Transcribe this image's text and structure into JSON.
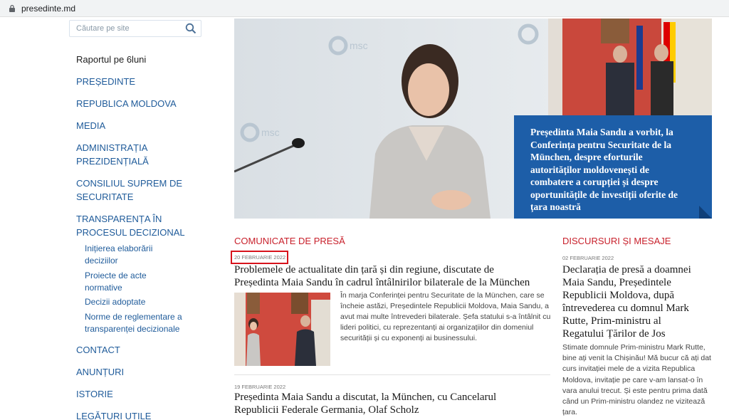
{
  "browser": {
    "url": "presedinte.md"
  },
  "search": {
    "placeholder": "Căutare pe site"
  },
  "sidebar": {
    "items": [
      {
        "label": "Raportul pe 6luni"
      },
      {
        "label": "PREȘEDINTE"
      },
      {
        "label": "REPUBLICA MOLDOVA"
      },
      {
        "label": "MEDIA"
      },
      {
        "label": "ADMINISTRAȚIA"
      },
      {
        "label": "PREZIDENȚIALĂ"
      },
      {
        "label": "CONSILIUL SUPREM DE"
      },
      {
        "label": "SECURITATE"
      },
      {
        "label": "TRANSPARENȚA ÎN"
      },
      {
        "label": "PROCESUL DECIZIONAL"
      },
      {
        "label": "Inițierea elaborării"
      },
      {
        "label": "deciziilor"
      },
      {
        "label": "Proiecte de acte"
      },
      {
        "label": "normative"
      },
      {
        "label": "Decizii adoptate"
      },
      {
        "label": "Norme de reglementare a"
      },
      {
        "label": "transparenței decizionale"
      },
      {
        "label": "CONTACT"
      },
      {
        "label": "ANUNȚURI"
      },
      {
        "label": "ISTORIE"
      },
      {
        "label": "LEGĂTURI UTILE"
      }
    ]
  },
  "hero": {
    "caption_lines": [
      "Președinta Maia Sandu a vorbit, la",
      "Conferința pentru Securitate de la",
      "München, despre eforturile",
      "autorităților moldovenești de",
      "combatere a corupției și despre",
      "oportunitățile de investiții oferite de",
      "țara noastră"
    ],
    "logo_text": "msc"
  },
  "press": {
    "title": "COMUNICATE DE PRESĂ",
    "items": [
      {
        "date": "20 FEBRUARIE 2022",
        "headline_lines": [
          "Problemele de actualitate din țară și din regiune, discutate de",
          "Președinta Maia Sandu în cadrul întâlnirilor bilaterale de la München"
        ],
        "excerpt_lines": [
          "În marja Conferinței pentru Securitate de la München, care se",
          "încheie astăzi, Președintele Republicii Moldova, Maia Sandu, a",
          "avut mai multe întrevederi bilaterale. Șefa statului s-a întâlnit cu",
          "lideri politici, cu reprezentanți ai organizațiilor din domeniul",
          "securității și cu exponenți ai businessului."
        ]
      },
      {
        "date": "19 FEBRUARIE 2022",
        "headline_lines": [
          "Președinta Maia Sandu a discutat, la München, cu Cancelarul",
          "Republicii Federale Germania, Olaf Scholz"
        ]
      }
    ]
  },
  "speeches": {
    "title": "DISCURSURI ȘI MESAJE",
    "item": {
      "date": "02 FEBRUARIE 2022",
      "headline_lines": [
        "Declarația de presă a doamnei",
        "Maia Sandu, Președintele",
        "Republicii Moldova, după",
        "întrevederea cu domnul Mark",
        "Rutte, Prim-ministru al",
        "Regatului Țărilor de Jos"
      ],
      "excerpt_lines": [
        "Stimate domnule Prim-ministru Mark Rutte,",
        "bine ați venit la Chișinău! Mă bucur că ați dat",
        "curs invitației mele de a vizita Republica",
        "Moldova, invitație pe care v-am lansat-o în",
        "vara anului trecut. Și este pentru prima dată",
        "când un Prim-ministru olandez ne vizitează",
        "țara."
      ]
    }
  },
  "colors": {
    "accent_red": "#c8202b",
    "link_blue": "#1f5b9a",
    "caption_blue": "#1d5ea8",
    "highlight_box": "#d7131c"
  }
}
